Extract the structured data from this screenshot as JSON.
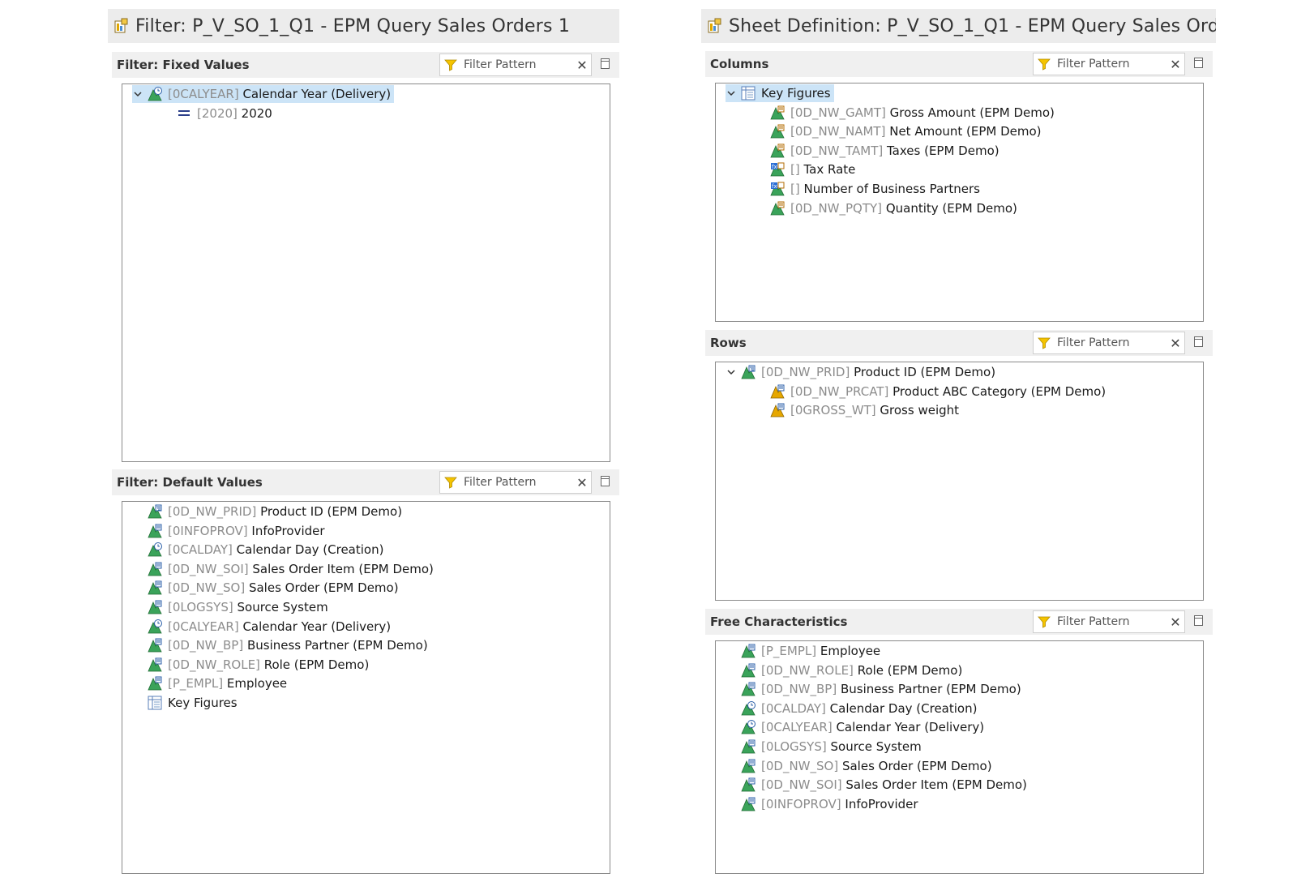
{
  "filter_pane": {
    "title": "Filter: P_V_SO_1_Q1 - EPM Query Sales Orders 1",
    "fixed": {
      "label": "Filter: Fixed Values",
      "placeholder": "Filter Pattern",
      "items": [
        {
          "tech": "[0CALYEAR]",
          "text": "Calendar Year (Delivery)",
          "icon": "time-characteristic-icon",
          "expanded": true,
          "selected": true
        },
        {
          "tech": "[2020]",
          "text": "2020",
          "icon": "equals-icon"
        }
      ]
    },
    "default": {
      "label": "Filter: Default Values",
      "placeholder": "Filter Pattern",
      "items": [
        {
          "tech": "[0D_NW_PRID]",
          "text": "Product ID (EPM Demo)",
          "icon": "hierarchy-characteristic-icon"
        },
        {
          "tech": "[0INFOPROV]",
          "text": "InfoProvider",
          "icon": "characteristic-icon"
        },
        {
          "tech": "[0CALDAY]",
          "text": "Calendar Day (Creation)",
          "icon": "time-characteristic-icon"
        },
        {
          "tech": "[0D_NW_SOI]",
          "text": "Sales Order Item (EPM Demo)",
          "icon": "characteristic-icon"
        },
        {
          "tech": "[0D_NW_SO]",
          "text": "Sales Order (EPM Demo)",
          "icon": "characteristic-icon"
        },
        {
          "tech": "[0LOGSYS]",
          "text": "Source System",
          "icon": "characteristic-icon"
        },
        {
          "tech": "[0CALYEAR]",
          "text": "Calendar Year (Delivery)",
          "icon": "time-characteristic-icon"
        },
        {
          "tech": "[0D_NW_BP]",
          "text": "Business Partner (EPM Demo)",
          "icon": "characteristic-icon"
        },
        {
          "tech": "[0D_NW_ROLE]",
          "text": "Role (EPM Demo)",
          "icon": "characteristic-icon"
        },
        {
          "tech": "[P_EMPL]",
          "text": "Employee",
          "icon": "characteristic-icon"
        },
        {
          "tech": "",
          "text": "Key Figures",
          "icon": "key-figures-icon"
        }
      ]
    }
  },
  "sheet_pane": {
    "title": "Sheet Definition: P_V_SO_1_Q1 - EPM Query Sales Ord",
    "columns": {
      "label": "Columns",
      "placeholder": "Filter Pattern",
      "items": [
        {
          "tech": "",
          "text": "Key Figures",
          "icon": "key-figures-icon",
          "expanded": true,
          "selected": true
        },
        {
          "tech": "[0D_NW_GAMT]",
          "text": "Gross Amount (EPM Demo)",
          "icon": "key-figure-icon"
        },
        {
          "tech": "[0D_NW_NAMT]",
          "text": "Net Amount (EPM Demo)",
          "icon": "key-figure-icon"
        },
        {
          "tech": "[0D_NW_TAMT]",
          "text": "Taxes (EPM Demo)",
          "icon": "key-figure-icon"
        },
        {
          "tech": "[]",
          "text": "Tax Rate",
          "icon": "calculated-key-figure-icon"
        },
        {
          "tech": "[]",
          "text": "Number of Business Partners",
          "icon": "calculated-key-figure-icon"
        },
        {
          "tech": "[0D_NW_PQTY]",
          "text": "Quantity (EPM Demo)",
          "icon": "key-figure-icon"
        }
      ]
    },
    "rows": {
      "label": "Rows",
      "placeholder": "Filter Pattern",
      "items": [
        {
          "tech": "[0D_NW_PRID]",
          "text": "Product ID (EPM Demo)",
          "icon": "hierarchy-characteristic-icon",
          "expanded": true
        },
        {
          "tech": "[0D_NW_PRCAT]",
          "text": "Product ABC Category (EPM Demo)",
          "icon": "attribute-icon"
        },
        {
          "tech": "[0GROSS_WT]",
          "text": "Gross weight",
          "icon": "attribute-icon"
        }
      ]
    },
    "free": {
      "label": "Free Characteristics",
      "placeholder": "Filter Pattern",
      "items": [
        {
          "tech": "[P_EMPL]",
          "text": "Employee",
          "icon": "characteristic-icon"
        },
        {
          "tech": "[0D_NW_ROLE]",
          "text": "Role (EPM Demo)",
          "icon": "characteristic-icon"
        },
        {
          "tech": "[0D_NW_BP]",
          "text": "Business Partner (EPM Demo)",
          "icon": "characteristic-icon"
        },
        {
          "tech": "[0CALDAY]",
          "text": "Calendar Day (Creation)",
          "icon": "time-characteristic-icon"
        },
        {
          "tech": "[0CALYEAR]",
          "text": "Calendar Year (Delivery)",
          "icon": "time-characteristic-icon"
        },
        {
          "tech": "[0LOGSYS]",
          "text": "Source System",
          "icon": "characteristic-icon"
        },
        {
          "tech": "[0D_NW_SO]",
          "text": "Sales Order (EPM Demo)",
          "icon": "characteristic-icon"
        },
        {
          "tech": "[0D_NW_SOI]",
          "text": "Sales Order Item (EPM Demo)",
          "icon": "characteristic-icon"
        },
        {
          "tech": "[0INFOPROV]",
          "text": "InfoProvider",
          "icon": "characteristic-icon"
        }
      ]
    }
  }
}
